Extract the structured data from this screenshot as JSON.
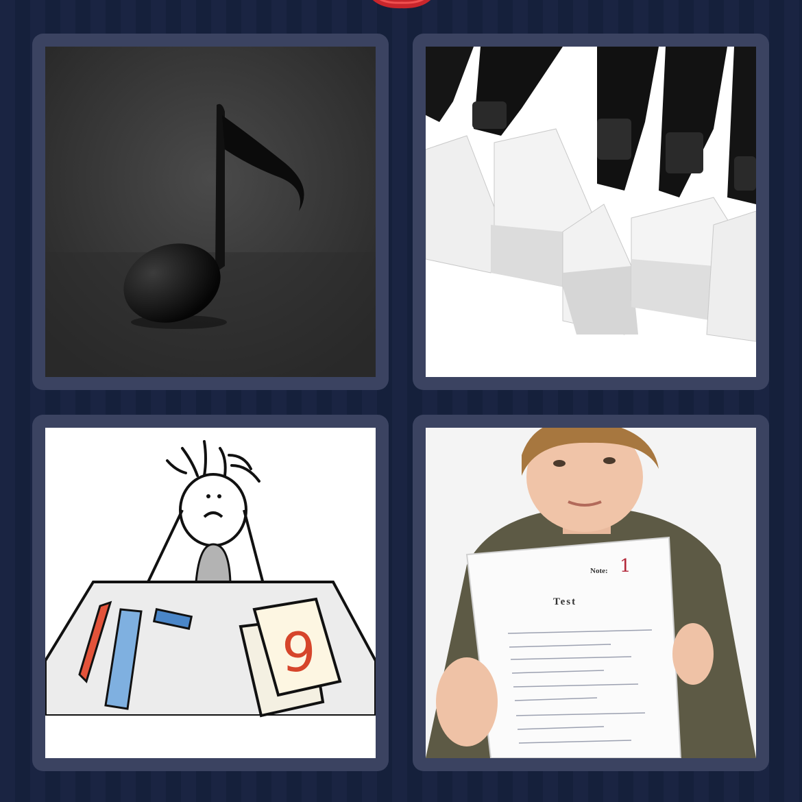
{
  "tiles": [
    {
      "subject": "music-note"
    },
    {
      "subject": "piano-keys"
    },
    {
      "subject": "student-grade-9"
    },
    {
      "subject": "boy-holding-test"
    }
  ],
  "test_sheet": {
    "note_label": "Note:",
    "grade": "1",
    "title": "Test"
  },
  "cartoon": {
    "grade": "9"
  },
  "colors": {
    "background": "#18213d",
    "tile_frame": "#3b4361",
    "badge": "#d83a3a",
    "grade_ink": "#d6452b"
  }
}
